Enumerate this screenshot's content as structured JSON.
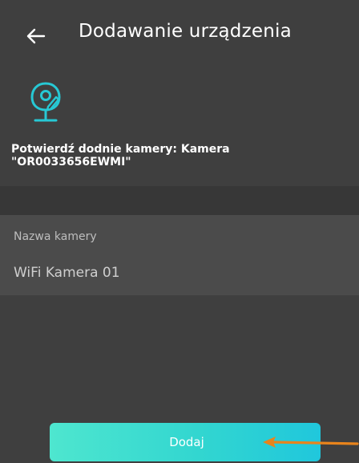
{
  "header": {
    "back_icon": "arrow-left-icon",
    "title": "Dodawanie urządzenia"
  },
  "device": {
    "icon": "camera-icon",
    "confirm_line1": "Potwierdź dodnie kamery: Kamera",
    "confirm_line2": "\"OR0033656EWMI\""
  },
  "form": {
    "name_label": "Nazwa kamery",
    "name_value": "WiFi Kamera 01"
  },
  "footer": {
    "add_label": "Dodaj"
  },
  "colors": {
    "background": "#3f3f3f",
    "panel": "#4b4b4b",
    "accent": "#2fcfd8",
    "arrow_annotation": "#e8841c"
  }
}
